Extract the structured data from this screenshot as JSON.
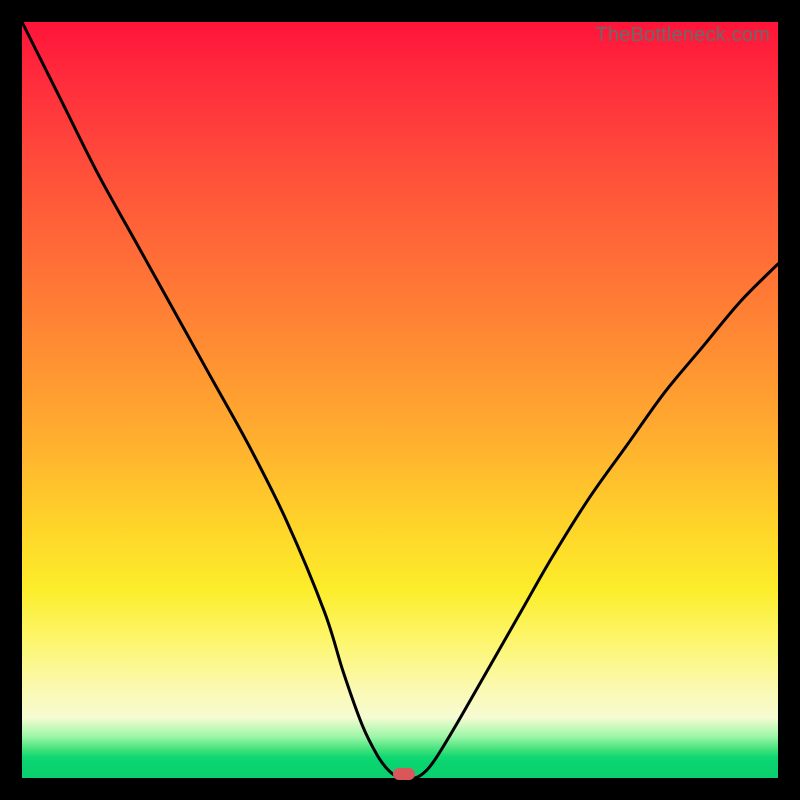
{
  "attribution": "TheBottleneck.com",
  "colors": {
    "marker_fill": "#d9575b",
    "curve_stroke": "#000000"
  },
  "chart_data": {
    "type": "line",
    "title": "",
    "xlabel": "",
    "ylabel": "",
    "xlim": [
      0,
      100
    ],
    "ylim": [
      0,
      100
    ],
    "grid": false,
    "legend": false,
    "series": [
      {
        "name": "bottleneck-curve",
        "x": [
          0,
          5,
          10,
          15,
          20,
          25,
          30,
          35,
          40,
          42.5,
          45,
          47,
          48.5,
          50,
          52,
          53.5,
          55,
          58,
          62,
          66,
          70,
          75,
          80,
          85,
          90,
          95,
          100
        ],
        "values": [
          100,
          90,
          80,
          71,
          62,
          53,
          44,
          34,
          22,
          14,
          7,
          3,
          1,
          0,
          0,
          1,
          3,
          8,
          15,
          22,
          29,
          37,
          44,
          51,
          57,
          63,
          68
        ]
      }
    ],
    "marker": {
      "x": 50.5,
      "y": 0.5,
      "shape": "pill"
    },
    "gradient_stops": [
      {
        "pos": 0,
        "color": "#ff143a"
      },
      {
        "pos": 50,
        "color": "#ff8a33"
      },
      {
        "pos": 75,
        "color": "#fced2a"
      },
      {
        "pos": 96,
        "color": "#12d873"
      },
      {
        "pos": 100,
        "color": "#0bcf6e"
      }
    ]
  }
}
